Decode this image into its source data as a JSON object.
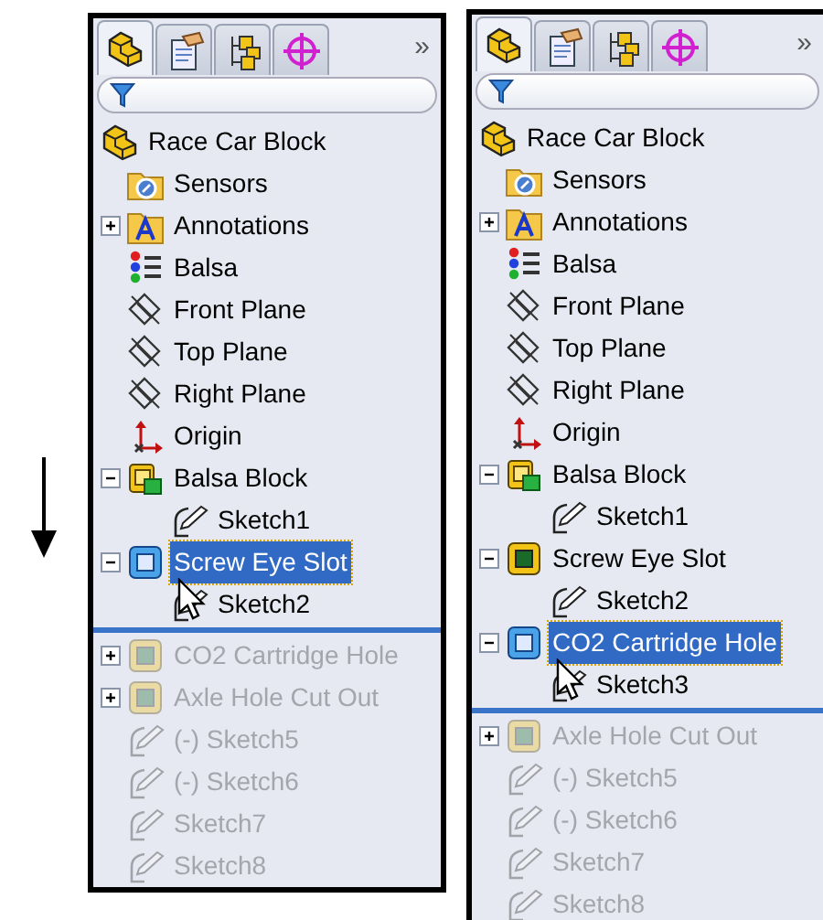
{
  "panels": [
    {
      "tabs": [
        {
          "kind": "feature-tree",
          "selected": true
        },
        {
          "kind": "properties",
          "selected": false
        },
        {
          "kind": "configurations",
          "selected": false
        },
        {
          "kind": "dimxpert",
          "selected": false
        }
      ],
      "more": "»",
      "tree": [
        {
          "label": "Race Car Block",
          "kind": "part",
          "selected": false,
          "rolled_back": false,
          "children": [
            {
              "label": "Sensors",
              "kind": "sensors",
              "selected": false,
              "rolled_back": false
            },
            {
              "label": "Annotations",
              "kind": "annotations",
              "selected": false,
              "rolled_back": false,
              "expanded": false
            },
            {
              "label": "Balsa",
              "kind": "material",
              "selected": false,
              "rolled_back": false
            },
            {
              "label": "Front Plane",
              "kind": "plane",
              "selected": false,
              "rolled_back": false
            },
            {
              "label": "Top Plane",
              "kind": "plane",
              "selected": false,
              "rolled_back": false
            },
            {
              "label": "Right Plane",
              "kind": "plane",
              "selected": false,
              "rolled_back": false
            },
            {
              "label": "Origin",
              "kind": "origin",
              "selected": false,
              "rolled_back": false
            },
            {
              "label": "Balsa Block",
              "kind": "boss",
              "selected": false,
              "rolled_back": false,
              "expanded": true,
              "children": [
                {
                  "label": "Sketch1",
                  "kind": "sketch",
                  "selected": false,
                  "rolled_back": false
                }
              ]
            },
            {
              "label": "Screw Eye Slot",
              "kind": "cut",
              "selected": true,
              "rolled_back": false,
              "expanded": true,
              "children": [
                {
                  "label": "Sketch2",
                  "kind": "sketch",
                  "selected": false,
                  "rolled_back": false
                }
              ]
            },
            {
              "label": "CO2 Cartridge Hole",
              "kind": "cut",
              "selected": false,
              "rolled_back": true,
              "expanded": false
            },
            {
              "label": "Axle Hole Cut Out",
              "kind": "cut",
              "selected": false,
              "rolled_back": true,
              "expanded": false
            },
            {
              "label": "(-) Sketch5",
              "kind": "sketch",
              "selected": false,
              "rolled_back": true
            },
            {
              "label": "(-) Sketch6",
              "kind": "sketch",
              "selected": false,
              "rolled_back": true
            },
            {
              "label": "Sketch7",
              "kind": "sketch",
              "selected": false,
              "rolled_back": true
            },
            {
              "label": "Sketch8",
              "kind": "sketch",
              "selected": false,
              "rolled_back": true
            }
          ]
        }
      ]
    },
    {
      "tabs": [
        {
          "kind": "feature-tree",
          "selected": true
        },
        {
          "kind": "properties",
          "selected": false
        },
        {
          "kind": "configurations",
          "selected": false
        },
        {
          "kind": "dimxpert",
          "selected": false
        }
      ],
      "more": "»",
      "tree": [
        {
          "label": "Race Car Block",
          "kind": "part",
          "selected": false,
          "rolled_back": false,
          "children": [
            {
              "label": "Sensors",
              "kind": "sensors",
              "selected": false,
              "rolled_back": false
            },
            {
              "label": "Annotations",
              "kind": "annotations",
              "selected": false,
              "rolled_back": false,
              "expanded": false
            },
            {
              "label": "Balsa",
              "kind": "material",
              "selected": false,
              "rolled_back": false
            },
            {
              "label": "Front Plane",
              "kind": "plane",
              "selected": false,
              "rolled_back": false
            },
            {
              "label": "Top Plane",
              "kind": "plane",
              "selected": false,
              "rolled_back": false
            },
            {
              "label": "Right Plane",
              "kind": "plane",
              "selected": false,
              "rolled_back": false
            },
            {
              "label": "Origin",
              "kind": "origin",
              "selected": false,
              "rolled_back": false
            },
            {
              "label": "Balsa Block",
              "kind": "boss",
              "selected": false,
              "rolled_back": false,
              "expanded": true,
              "children": [
                {
                  "label": "Sketch1",
                  "kind": "sketch",
                  "selected": false,
                  "rolled_back": false
                }
              ]
            },
            {
              "label": "Screw Eye Slot",
              "kind": "cut",
              "selected": false,
              "rolled_back": false,
              "expanded": true,
              "children": [
                {
                  "label": "Sketch2",
                  "kind": "sketch",
                  "selected": false,
                  "rolled_back": false
                }
              ]
            },
            {
              "label": "CO2 Cartridge Hole",
              "kind": "cut",
              "selected": true,
              "rolled_back": false,
              "expanded": true,
              "children": [
                {
                  "label": "Sketch3",
                  "kind": "sketch",
                  "selected": false,
                  "rolled_back": false
                }
              ]
            },
            {
              "label": "Axle Hole Cut Out",
              "kind": "cut",
              "selected": false,
              "rolled_back": true,
              "expanded": false
            },
            {
              "label": "(-) Sketch5",
              "kind": "sketch",
              "selected": false,
              "rolled_back": true
            },
            {
              "label": "(-) Sketch6",
              "kind": "sketch",
              "selected": false,
              "rolled_back": true
            },
            {
              "label": "Sketch7",
              "kind": "sketch",
              "selected": false,
              "rolled_back": true
            },
            {
              "label": "Sketch8",
              "kind": "sketch",
              "selected": false,
              "rolled_back": true
            }
          ]
        }
      ]
    }
  ]
}
